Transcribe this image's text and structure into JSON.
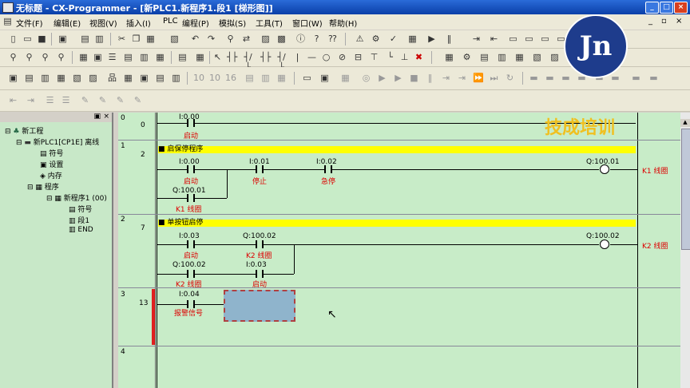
{
  "window": {
    "title": "无标题 - CX-Programmer - [新PLC1.新程序1.段1 [梯形图]]"
  },
  "menu": [
    "文件(F)",
    "编辑(E)",
    "视图(V)",
    "插入(I)",
    "PLC",
    "编程(P)",
    "模拟(S)",
    "工具(T)",
    "窗口(W)",
    "帮助(H)"
  ],
  "tree": {
    "project": "新工程",
    "plc": "新PLC1[CP1E] 离线",
    "symbols": "符号",
    "settings": "设置",
    "memory": "内存",
    "programs": "程序",
    "program1": "新程序1 (00)",
    "prog_symbols": "符号",
    "section1": "段1",
    "end": "END"
  },
  "rungs": [
    {
      "rung": "0",
      "step": "0"
    },
    {
      "rung": "1",
      "step": "2",
      "comment": "启保停程序"
    },
    {
      "rung": "2",
      "step": "7",
      "comment": "单按钮启停"
    },
    {
      "rung": "3",
      "step": "13"
    },
    {
      "rung": "4",
      "step": ""
    }
  ],
  "ladder": {
    "r0_addr": "I:0.00",
    "r0_name": "启动",
    "r1_c1_addr": "I:0.00",
    "r1_c1_name": "启动",
    "r1_c2_addr": "I:0.01",
    "r1_c2_name": "停止",
    "r1_c3_addr": "I:0.02",
    "r1_c3_name": "急停",
    "r1_p_addr": "Q:100.01",
    "r1_p_name": "K1 线圈",
    "r1_coil_addr": "Q:100.01",
    "r1_coil_name": "K1 线圈",
    "r2_c1_addr": "I:0.03",
    "r2_c1_name": "启动",
    "r2_c2_addr": "Q:100.02",
    "r2_c2_name": "K2 线圈",
    "r2_c3_addr": "Q:100.02",
    "r2_c3_name": "K2 线圈",
    "r2_c4_addr": "I:0.03",
    "r2_c4_name": "启动",
    "r2_coil_addr": "Q:100.02",
    "r2_coil_name": "K2 线圈",
    "r3_c1_addr": "I:0.04",
    "r3_c1_name": "报警信号"
  },
  "overlay": {
    "logo_text": "Jn",
    "brand": "技成培训"
  },
  "colors": {
    "comment_bg": "#ffff00",
    "ladder_bg": "#c8ecc8",
    "active_rung": "#e02020"
  }
}
